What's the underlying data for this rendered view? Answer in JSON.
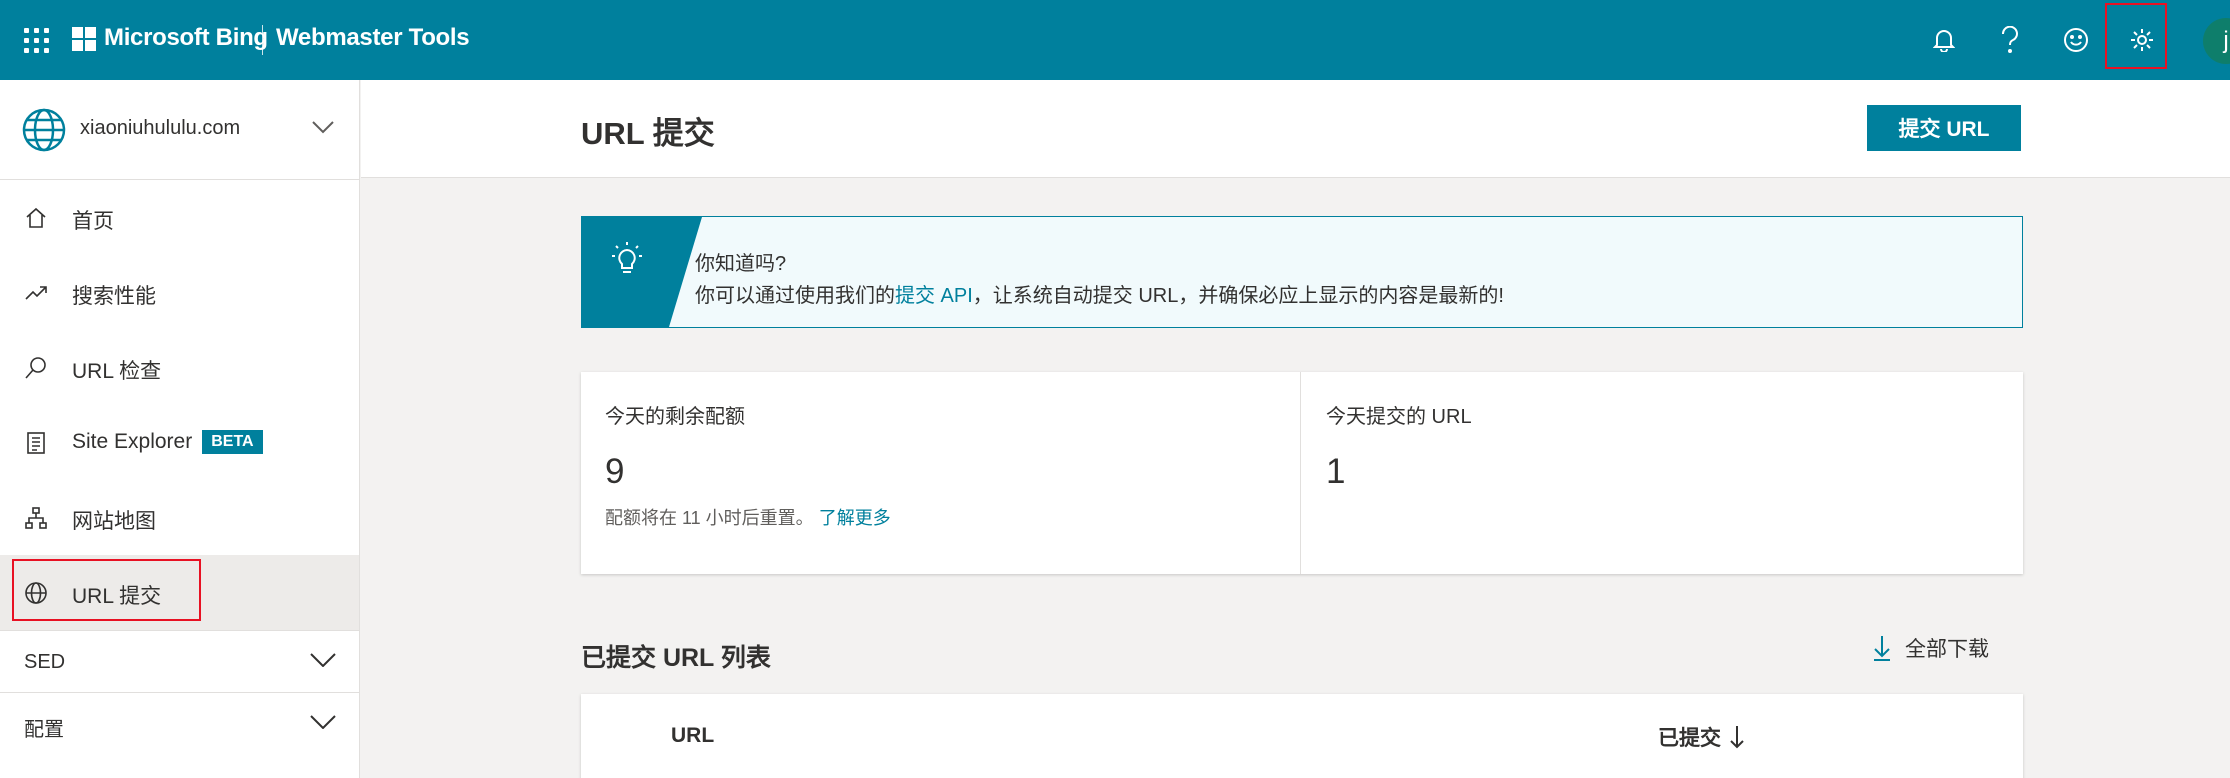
{
  "header": {
    "brand": "Microsoft Bing",
    "product": "Webmaster Tools",
    "avatar_initial": "j",
    "accent": "#00809d"
  },
  "sidebar": {
    "site": "xiaoniuhululu.com",
    "items": [
      {
        "label": "首页",
        "icon": "home-icon"
      },
      {
        "label": "搜索性能",
        "icon": "trend-icon"
      },
      {
        "label": "URL 检查",
        "icon": "search-icon"
      },
      {
        "label": "Site Explorer",
        "icon": "document-list-icon",
        "badge": "BETA"
      },
      {
        "label": "网站地图",
        "icon": "sitemap-icon"
      },
      {
        "label": "URL 提交",
        "icon": "globe-icon",
        "active": true
      }
    ],
    "sections": [
      {
        "label": "SED"
      },
      {
        "label": "配置"
      }
    ]
  },
  "main": {
    "title": "URL 提交",
    "submit_button": "提交 URL",
    "tip": {
      "title": "你知道吗?",
      "body_prefix": "你可以通过使用我们的",
      "link": "提交 API",
      "body_suffix": "，让系统自动提交 URL，并确保必应上显示的内容是最新的!"
    },
    "stats": {
      "quota_label": "今天的剩余配额",
      "quota_value": "9",
      "quota_note": "配额将在 11 小时后重置。",
      "learn_more": "了解更多",
      "today_label": "今天提交的 URL",
      "today_value": "1"
    },
    "list": {
      "title": "已提交 URL 列表",
      "download": "全部下载",
      "col_url": "URL",
      "col_submitted": "已提交"
    }
  }
}
